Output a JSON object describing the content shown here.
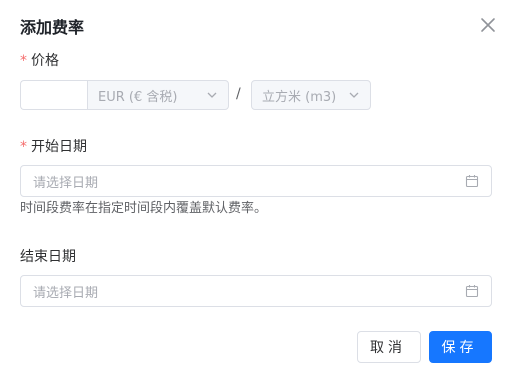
{
  "dialog": {
    "title": "添加费率"
  },
  "price": {
    "label": "价格",
    "required_mark": "*",
    "value": "",
    "currency_value": "EUR (€ 含税)",
    "separator": "/",
    "unit_value": "立方米 (m3)"
  },
  "start_date": {
    "label": "开始日期",
    "required_mark": "*",
    "placeholder": "请选择日期",
    "hint": "时间段费率在指定时间段内覆盖默认费率。"
  },
  "end_date": {
    "label": "结束日期",
    "placeholder": "请选择日期"
  },
  "footer": {
    "cancel_label": "取消",
    "save_label": "保存"
  },
  "colors": {
    "primary": "#1677ff",
    "required": "#f56c6c"
  },
  "icons": {
    "close": "close-icon",
    "chevron": "chevron-down-icon",
    "calendar": "calendar-icon"
  }
}
